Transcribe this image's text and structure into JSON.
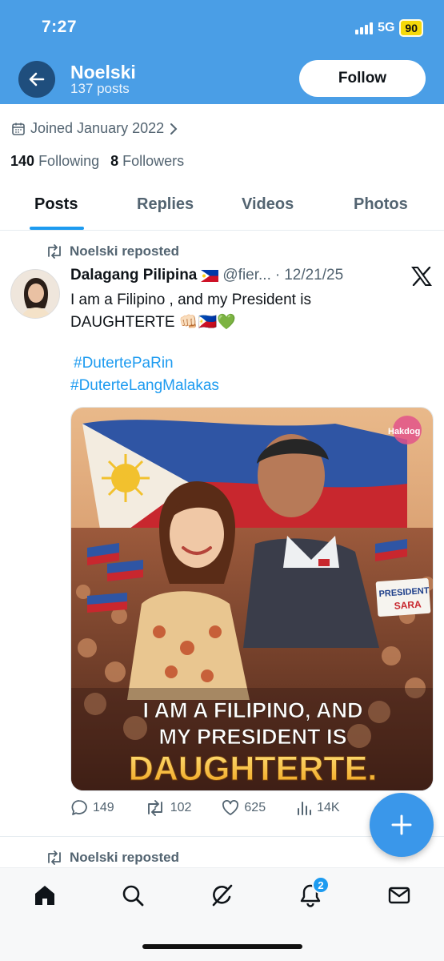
{
  "status_bar": {
    "time": "7:27",
    "network": "5G",
    "battery": "90"
  },
  "header": {
    "name": "Noelski",
    "posts_count": "137 posts",
    "follow_label": "Follow",
    "icons": {
      "back": "arrow-left-icon"
    }
  },
  "profile": {
    "joined": "Joined January 2022",
    "following_count": "140",
    "following_label": "Following",
    "followers_count": "8",
    "followers_label": "Followers"
  },
  "tabs": [
    {
      "label": "Posts",
      "active": true
    },
    {
      "label": "Replies",
      "active": false
    },
    {
      "label": "Videos",
      "active": false
    },
    {
      "label": "Photos",
      "active": false
    }
  ],
  "post": {
    "repost_label": "Noelski reposted",
    "author": "Dalagang Pilipina",
    "handle": "@fier...",
    "separator": "·",
    "date": "12/21/25",
    "text_line1": "I am a Filipino , and my President is",
    "text_line2": "DAUGHTERTE",
    "text_emoji": "👊🏻🇵🇭💚",
    "hashtags": [
      "#DutertePaRin",
      "#DuterteLangMalakas"
    ],
    "image": {
      "watermark": "Hakdog",
      "sign_line1": "PRESIDENT",
      "sign_line2": "SARA",
      "headline_line1": "I AM A FILIPINO, AND",
      "headline_line2": "MY PRESIDENT IS",
      "headline_line3": "DAUGHTERTE."
    },
    "stats": {
      "replies": "149",
      "reposts": "102",
      "likes": "625",
      "views": "14K"
    }
  },
  "next_post": {
    "repost_label": "Noelski reposted"
  },
  "bottom_nav": {
    "notifications_badge": "2",
    "icons": [
      "home-icon",
      "search-icon",
      "grok-icon",
      "notifications-icon",
      "messages-icon"
    ]
  },
  "colors": {
    "header_bg": "#4a9ee6",
    "accent": "#1d9bf0",
    "text": "#0f1419",
    "muted": "#536471"
  }
}
